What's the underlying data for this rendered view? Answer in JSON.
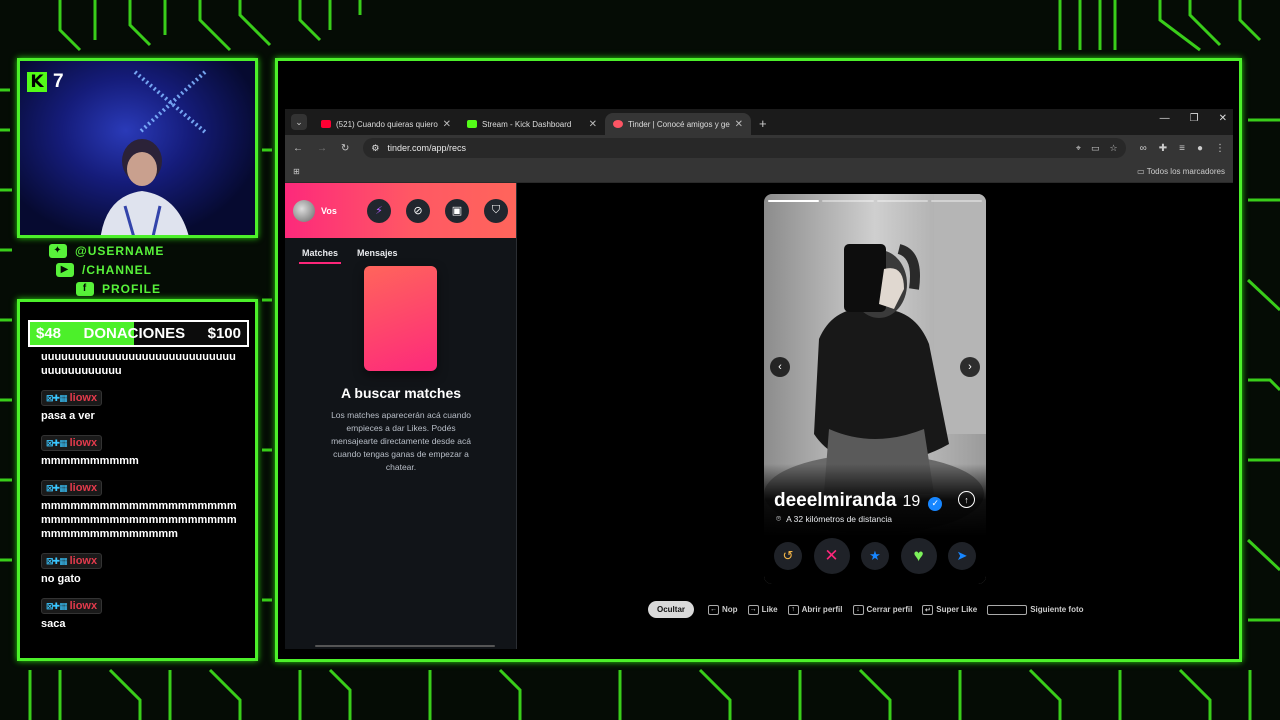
{
  "overlay": {
    "kick_viewers": "7",
    "socials": [
      {
        "icon": "twitter-icon",
        "label": "@USERNAME"
      },
      {
        "icon": "youtube-icon",
        "label": "/CHANNEL"
      },
      {
        "icon": "facebook-icon",
        "label": "PROFILE"
      }
    ],
    "donations": {
      "current": "$48",
      "label": "DONACIONES",
      "goal": "$100",
      "progress": 0.48
    },
    "chat": [
      {
        "user": "",
        "text": "uuuuuuuuuuuuuuuuuuuuuuuuuuuuuuuuuuuuuuuuu"
      },
      {
        "user": "liowx",
        "text": "pasa a ver"
      },
      {
        "user": "liowx",
        "text": "mmmmmmmmmm"
      },
      {
        "user": "liowx",
        "text": "mmmmmmmmmmmmmmmmmmmmmmmmmmmmmmmmmmmmmmmmmmmmmmmmmmmmmm"
      },
      {
        "user": "liowx",
        "text": "no gato"
      },
      {
        "user": "liowx",
        "text": "saca"
      }
    ],
    "accent_color": "#4cf02a"
  },
  "browser": {
    "tabs": [
      {
        "title": "(521) Cuando quieras quiero - ",
        "favicon_color": "#ff0033",
        "active": false
      },
      {
        "title": "Stream - Kick Dashboard",
        "favicon_color": "#53fc18",
        "active": false
      },
      {
        "title": "Tinder | Conocé amigos y gent",
        "favicon_color": "#fd5564",
        "active": true
      }
    ],
    "url": "tinder.com/app/recs",
    "bookmarks_label": "Todos los marcadores"
  },
  "tinder": {
    "user_label": "Vos",
    "tabs": [
      "Matches",
      "Mensajes"
    ],
    "empty_title": "A buscar matches",
    "empty_text": "Los matches aparecerán acá cuando empieces a dar Likes. Podés mensajearte directamente desde acá cuando tengas ganas de empezar a chatear.",
    "brand_color": "#fd297b",
    "profile": {
      "name": "deeelmiranda",
      "age": "19",
      "distance": "A 32 kilómetros de distancia",
      "photo_count": 4,
      "photo_index": 1
    },
    "hints": {
      "hide": "Ocultar",
      "nope": "Nop",
      "like": "Like",
      "open": "Abrir perfil",
      "close": "Cerrar perfil",
      "superlike": "Super Like",
      "next": "Siguiente foto"
    }
  }
}
